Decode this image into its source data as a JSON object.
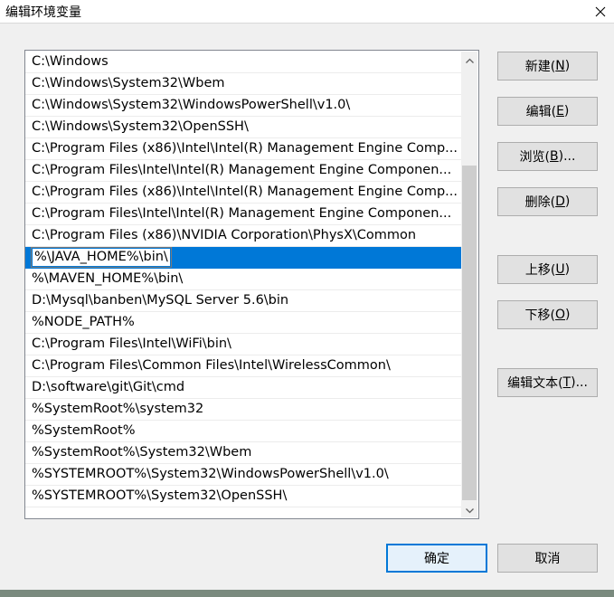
{
  "window": {
    "title": "编辑环境变量"
  },
  "paths": [
    "C:\\Windows",
    "C:\\Windows\\System32\\Wbem",
    "C:\\Windows\\System32\\WindowsPowerShell\\v1.0\\",
    "C:\\Windows\\System32\\OpenSSH\\",
    "C:\\Program Files (x86)\\Intel\\Intel(R) Management Engine Comp...",
    "C:\\Program Files\\Intel\\Intel(R) Management Engine Componen...",
    "C:\\Program Files (x86)\\Intel\\Intel(R) Management Engine Comp...",
    "C:\\Program Files\\Intel\\Intel(R) Management Engine Componen...",
    "C:\\Program Files (x86)\\NVIDIA Corporation\\PhysX\\Common",
    "%\\JAVA_HOME%\\bin\\",
    "%\\MAVEN_HOME%\\bin\\",
    "D:\\Mysql\\banben\\MySQL Server 5.6\\bin",
    "%NODE_PATH%",
    "C:\\Program Files\\Intel\\WiFi\\bin\\",
    "C:\\Program Files\\Common Files\\Intel\\WirelessCommon\\",
    "D:\\software\\git\\Git\\cmd",
    "%SystemRoot%\\system32",
    "%SystemRoot%",
    "%SystemRoot%\\System32\\Wbem",
    "%SYSTEMROOT%\\System32\\WindowsPowerShell\\v1.0\\",
    "%SYSTEMROOT%\\System32\\OpenSSH\\"
  ],
  "selected_index": 9,
  "buttons": {
    "new": {
      "text": "新建(",
      "key": "N",
      "end": ")"
    },
    "edit": {
      "text": "编辑(",
      "key": "E",
      "end": ")"
    },
    "browse": {
      "text": "浏览(",
      "key": "B",
      "end": ")..."
    },
    "delete": {
      "text": "删除(",
      "key": "D",
      "end": ")"
    },
    "up": {
      "text": "上移(",
      "key": "U",
      "end": ")"
    },
    "down": {
      "text": "下移(",
      "key": "O",
      "end": ")"
    },
    "edit_text": {
      "text": "编辑文本(",
      "key": "T",
      "end": ")..."
    },
    "ok": "确定",
    "cancel": "取消"
  },
  "colors": {
    "selection": "#0078d7",
    "default_button_border": "#0078d7"
  },
  "icons": {
    "close": "close-icon",
    "scroll_up": "chevron-up-icon",
    "scroll_down": "chevron-down-icon"
  }
}
